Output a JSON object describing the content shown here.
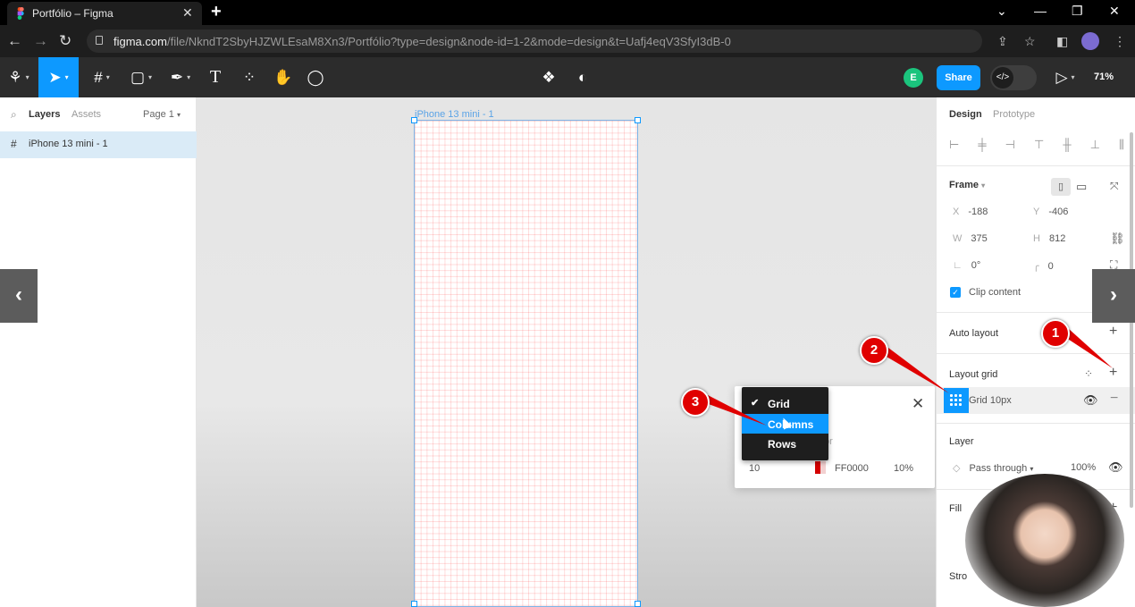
{
  "browser": {
    "tab_title": "Portfólio – Figma",
    "tab_close": "✕",
    "new_tab": "+",
    "url_domain": "figma.com",
    "url_path": "/file/NkndT2SbyHJZWLEsaM8Xn3/Portfólio?type=design&node-id=1-2&mode=design&t=Uafj4eqV3SfyI3dB-0",
    "window_controls": [
      "⌄",
      "—",
      "❐",
      "✕"
    ]
  },
  "toolbar": {
    "avatar_initial": "E",
    "share_label": "Share",
    "devmode_label": "</>",
    "zoom_label": "71%"
  },
  "left_panel": {
    "tab_layers": "Layers",
    "tab_assets": "Assets",
    "page_selector": "Page 1",
    "layers": [
      {
        "name": "iPhone 13 mini - 1"
      }
    ]
  },
  "canvas": {
    "frame_label": "iPhone 13 mini - 1"
  },
  "grid_popover": {
    "color_label": "or",
    "size_value": "10",
    "color_hex": "FF0000",
    "opacity": "10%",
    "close": "✕"
  },
  "grid_type_menu": {
    "items": [
      {
        "label": "Grid",
        "checked": true
      },
      {
        "label": "Columns",
        "highlighted": true
      },
      {
        "label": "Rows"
      }
    ]
  },
  "right_panel": {
    "tab_design": "Design",
    "tab_prototype": "Prototype",
    "frame_title": "Frame",
    "x_label": "X",
    "x_value": "-188",
    "y_label": "Y",
    "y_value": "-406",
    "w_label": "W",
    "w_value": "375",
    "h_label": "H",
    "h_value": "812",
    "rotation": "0°",
    "radius": "0",
    "clip_content": "Clip content",
    "auto_layout": "Auto layout",
    "layout_grid": "Layout grid",
    "grid_name": "Grid 10px",
    "layer_title": "Layer",
    "blend_mode": "Pass through",
    "layer_opacity": "100%",
    "fill_title": "Fill",
    "stroke_title": "Stro"
  },
  "annotations": [
    "1",
    "2",
    "3"
  ],
  "colors": {
    "accent": "#0d99ff",
    "marker": "#e00000",
    "grid_color": "#FF0000"
  }
}
